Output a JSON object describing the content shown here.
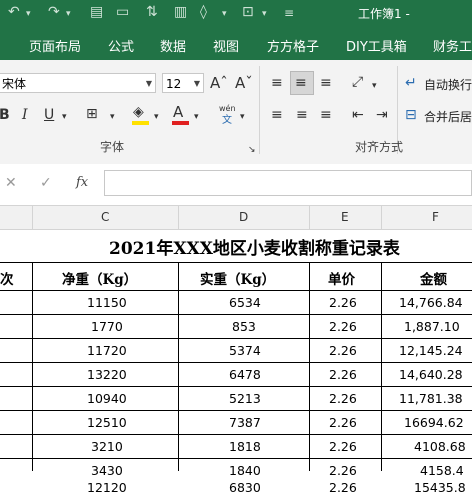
{
  "window": {
    "title": "工作簿1 -"
  },
  "ribbon_tabs": [
    "页面布局",
    "公式",
    "数据",
    "视图",
    "方方格子",
    "DIY工具箱",
    "财务工"
  ],
  "font_group": {
    "font_name": "宋体",
    "font_size": "12",
    "label": "字体",
    "bold": "B",
    "italic": "I",
    "underline": "U",
    "grow": "Aˆ",
    "shrink": "Aˇ",
    "wen": "wén",
    "wen2": "文",
    "font_color_letter": "A",
    "colors": {
      "highlight": "#ffe100",
      "font_color": "#e02020"
    }
  },
  "align_group": {
    "label": "对齐方式",
    "wrap_text": "自动换行",
    "merge_center": "合并后居"
  },
  "formula_bar": {
    "cancel": "✕",
    "confirm": "✓",
    "fx": "fx",
    "value": ""
  },
  "columns": [
    "C",
    "D",
    "E",
    "F"
  ],
  "sheet": {
    "title": "2021年XXX地区小麦收割称重记录表",
    "headers": [
      "次",
      "净重（Kg）",
      "实重（Kg）",
      "单价",
      "金额"
    ],
    "rows": [
      [
        "",
        "11150",
        "6534",
        "2.26",
        "14,766.84"
      ],
      [
        "",
        "1770",
        "853",
        "2.26",
        "1,887.10"
      ],
      [
        "",
        "11720",
        "5374",
        "2.26",
        "12,145.24"
      ],
      [
        "",
        "13220",
        "6478",
        "2.26",
        "14,640.28"
      ],
      [
        "",
        "10940",
        "5213",
        "2.26",
        "11,781.38"
      ],
      [
        "",
        "12510",
        "7387",
        "2.26",
        "16694.62"
      ],
      [
        "",
        "3210",
        "1818",
        "2.26",
        "4108.68"
      ],
      [
        "",
        "3430",
        "1840",
        "2.26",
        "4158.4"
      ],
      [
        "",
        "12120",
        "6830",
        "2.26",
        "15435.8"
      ]
    ]
  }
}
